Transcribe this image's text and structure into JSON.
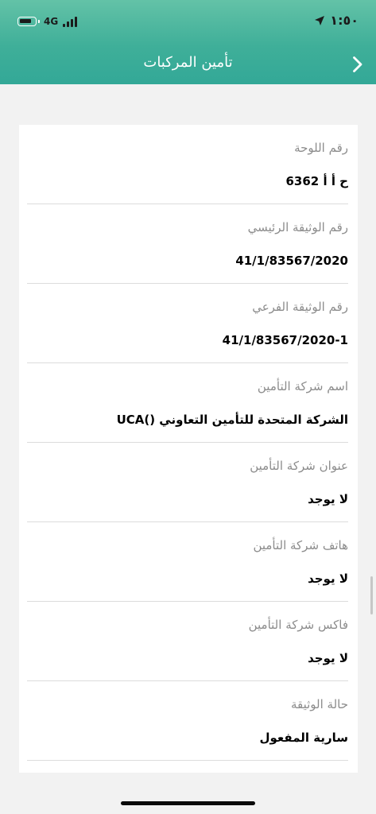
{
  "status_bar": {
    "network": "4G",
    "time": "١:٥٠"
  },
  "nav": {
    "title": "تأمين المركبات"
  },
  "fields": [
    {
      "label": "رقم اللوحة",
      "value": "ح أ أ 6362"
    },
    {
      "label": "رقم الوثيقة الرئيسي",
      "value": "41/1/83567/2020"
    },
    {
      "label": "رقم الوثيقة الفرعي",
      "value": "41/1/83567/2020-1"
    },
    {
      "label": "اسم شركة التأمين",
      "value": "الشركة المتحدة للتأمين التعاوني ()UCA"
    },
    {
      "label": "عنوان شركة التأمين",
      "value": "لا يوجد"
    },
    {
      "label": "هاتف شركة التأمين",
      "value": "لا يوجد"
    },
    {
      "label": "فاكس شركة التأمين",
      "value": "لا يوجد"
    },
    {
      "label": "حالة الوثيقة",
      "value": "سارية المفعول"
    }
  ],
  "colors": {
    "header_gradient_top": "#63c2a7",
    "header_gradient_bottom": "#33a897",
    "background": "#f2f2f2",
    "label_gray": "#8c8c8c"
  }
}
